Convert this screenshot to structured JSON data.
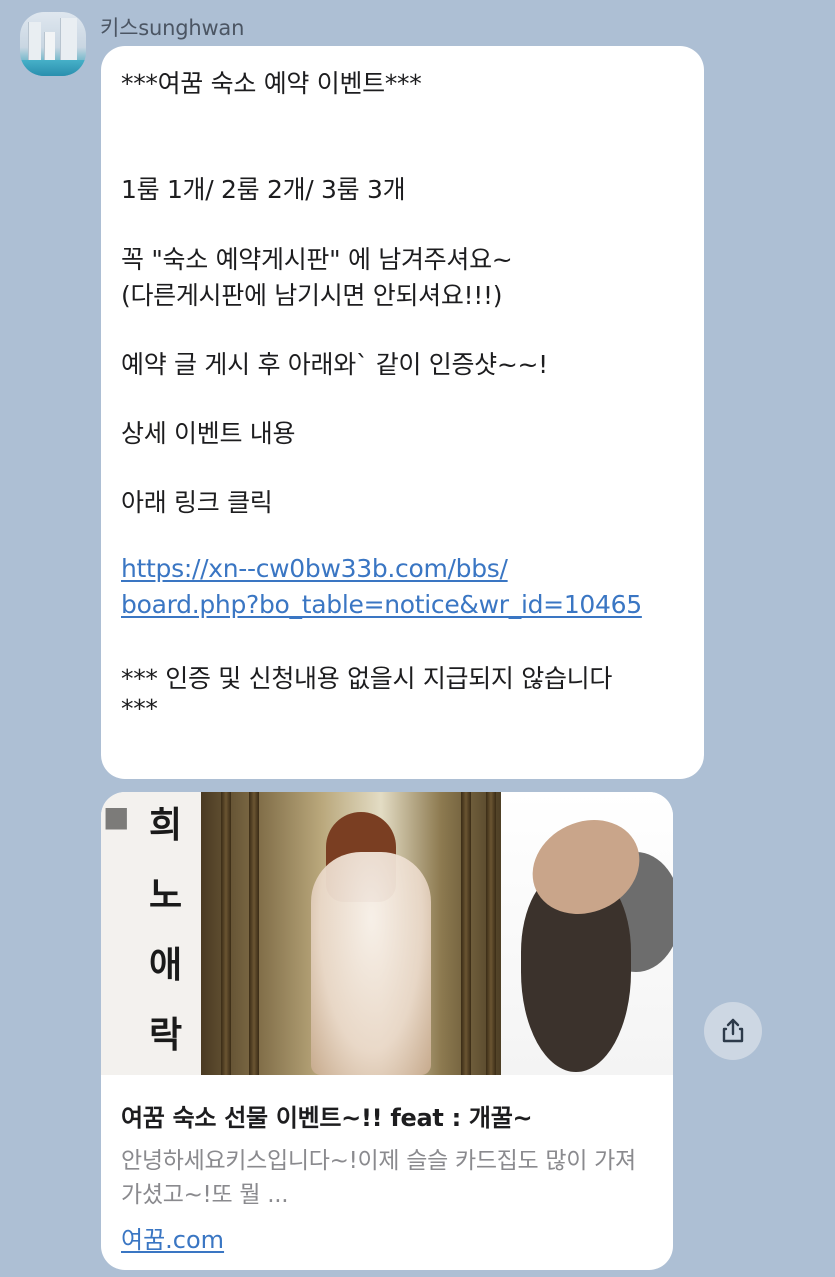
{
  "sender": {
    "name": "키스sunghwan"
  },
  "message": {
    "lines": [
      "***여꿈 숙소 예약 이벤트***",
      "1룸 1개/ 2룸 2개/ 3룸 3개",
      "꼭  \"숙소 예약게시판\" 에 남겨주셔요~",
      "(다른게시판에 남기시면 안되셔요!!!)",
      "예약 글 게시 후 아래와` 같이 인증샷~~!",
      "상세 이벤트 내용",
      "아래 링크 클릭",
      "https://xn--cw0bw33b.com/bbs/",
      "board.php?bo_table=notice&wr_id=10465",
      "*** 인증 및 신청내용 없을시 지급되지 않습니다",
      "***"
    ]
  },
  "link_preview": {
    "image_text": [
      "희",
      "노",
      "애",
      "락"
    ],
    "title": "여꿈 숙소 선물 이벤트~!! feat : 개꿀~",
    "description": "안녕하세요키스입니다~!이제 슬슬 카드집도 많이 가져가셨고~!또 뭘 ...",
    "domain": "여꿈.com"
  },
  "share_button": {
    "icon": "share-icon"
  }
}
